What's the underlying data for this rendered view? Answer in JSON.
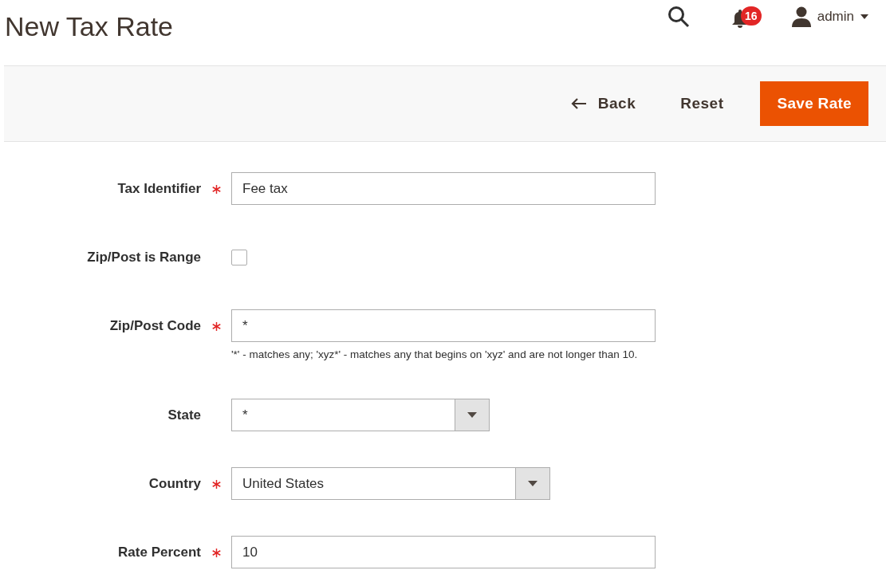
{
  "page_title": "New Tax Rate",
  "header": {
    "notifications_count": "16",
    "user": "admin"
  },
  "actions": {
    "back": "Back",
    "reset": "Reset",
    "save": "Save Rate"
  },
  "fields": [
    {
      "kind": "text",
      "label": "Tax Identifier",
      "required": true,
      "value": "Fee tax"
    },
    {
      "kind": "checkbox",
      "label": "Zip/Post is Range",
      "required": false,
      "checked": false
    },
    {
      "kind": "text",
      "label": "Zip/Post Code",
      "required": true,
      "value": "*",
      "hint": "'*' - matches any; 'xyz*' - matches any that begins on 'xyz' and are not longer than 10."
    },
    {
      "kind": "select",
      "label": "State",
      "required": false,
      "value": "*"
    },
    {
      "kind": "select",
      "label": "Country",
      "required": true,
      "value": "United States"
    },
    {
      "kind": "text",
      "label": "Rate Percent",
      "required": true,
      "value": "10"
    }
  ]
}
